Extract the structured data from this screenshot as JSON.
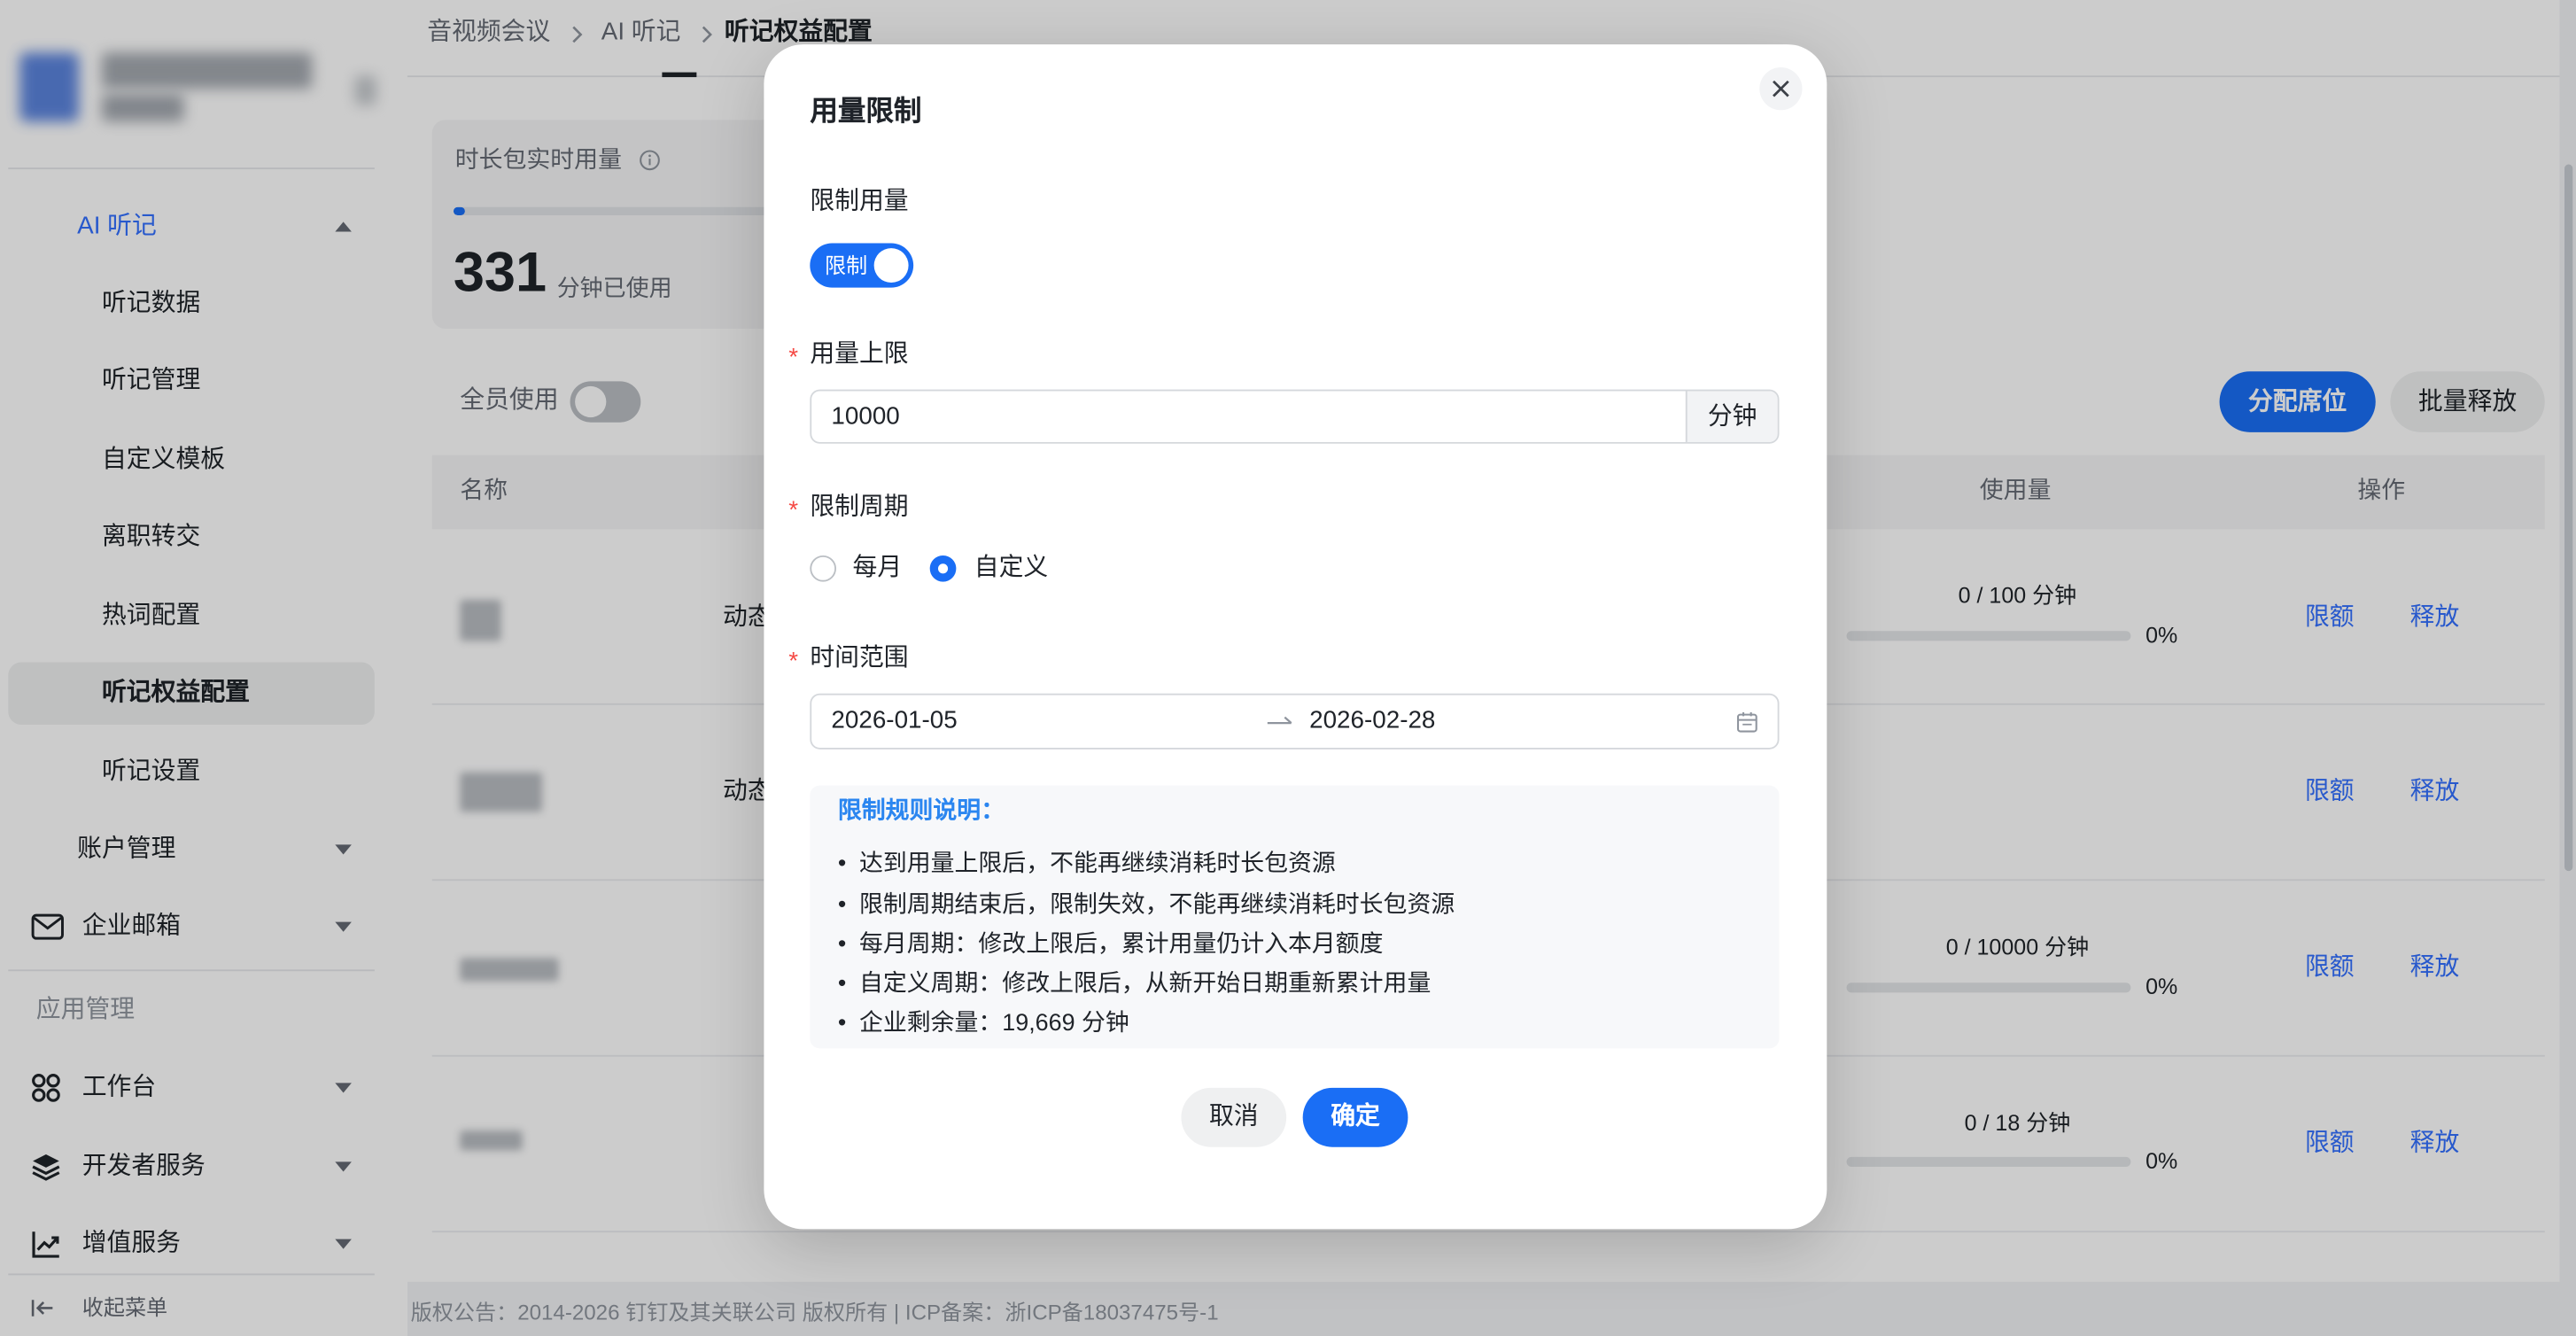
{
  "colors": {
    "brand_blue": "#1a6ef5",
    "link_blue": "#3370ff",
    "rules_title_blue": "#2b86f0",
    "text_primary": "#1f2329",
    "text_secondary": "#646a73",
    "text_muted": "#8f959e",
    "required_red": "#f54a45"
  },
  "sidebar": {
    "ai_group": {
      "label": "AI 听记",
      "expanded": true,
      "icon": "caret-up-icon",
      "items": [
        {
          "label": "听记数据",
          "active": false
        },
        {
          "label": "听记管理",
          "active": false
        },
        {
          "label": "自定义模板",
          "active": false
        },
        {
          "label": "离职转交",
          "active": false
        },
        {
          "label": "热词配置",
          "active": false
        },
        {
          "label": "听记权益配置",
          "active": true
        },
        {
          "label": "听记设置",
          "active": false
        }
      ]
    },
    "account": {
      "label": "账户管理",
      "icon": "caret-down-icon"
    },
    "mail": {
      "label": "企业邮箱",
      "icon": "mail-icon"
    },
    "section_title": "应用管理",
    "apps": [
      {
        "label": "工作台",
        "icon": "grid-icon"
      },
      {
        "label": "开发者服务",
        "icon": "layers-icon"
      },
      {
        "label": "增值服务",
        "icon": "trend-chart-icon"
      }
    ],
    "collapse": {
      "label": "收起菜单",
      "icon": "collapse-menu-icon"
    }
  },
  "breadcrumb": [
    "音视频会议",
    "AI 听记",
    "听记权益配置"
  ],
  "usage_card": {
    "title": "时长包实时用量",
    "value": "331",
    "unit": "分钟已使用",
    "fill_fraction": 0.0166
  },
  "toolbar": {
    "all_members_label": "全员使用",
    "all_members_on": false,
    "assign_seats": "分配席位",
    "batch_release": "批量释放"
  },
  "table": {
    "headers": {
      "name": "名称",
      "usage": "使用量",
      "actions": "操作"
    },
    "rows": [
      {
        "col2": "动态",
        "usage": "0 / 100 分钟",
        "percent": "0%",
        "fill_fraction": 0,
        "limit": "限额",
        "release": "释放"
      },
      {
        "col2": "动态",
        "limit": "限额",
        "release": "释放"
      },
      {
        "usage": "0 / 10000 分钟",
        "percent": "0%",
        "fill_fraction": 0,
        "limit": "限额",
        "release": "释放"
      },
      {
        "usage": "0 / 18 分钟",
        "percent": "0%",
        "fill_fraction": 0,
        "limit": "限额",
        "release": "释放"
      }
    ]
  },
  "footer": "版权公告：2014-2026 钉钉及其关联公司 版权所有 | ICP备案：浙ICP备18037475号-1",
  "modal": {
    "title": "用量限制",
    "close_icon": "close-icon",
    "limit_label": "限制用量",
    "limit_toggle_text": "限制",
    "limit_on": true,
    "required_mark": "*",
    "cap_label": "用量上限",
    "cap_value": "10000",
    "cap_unit": "分钟",
    "period_label": "限制周期",
    "period_options": [
      {
        "label": "每月",
        "checked": false
      },
      {
        "label": "自定义",
        "checked": true
      }
    ],
    "range_label": "时间范围",
    "range_start": "2026-01-05",
    "range_end": "2026-02-28",
    "rules_title": "限制规则说明：",
    "rules": [
      "达到用量上限后，不能再继续消耗时长包资源",
      "限制周期结束后，限制失效，不能再继续消耗时长包资源",
      "每月周期：修改上限后，累计用量仍计入本月额度",
      "自定义周期：修改上限后，从新开始日期重新累计用量",
      "企业剩余量：19,669 分钟"
    ],
    "cancel": "取消",
    "confirm": "确定"
  }
}
